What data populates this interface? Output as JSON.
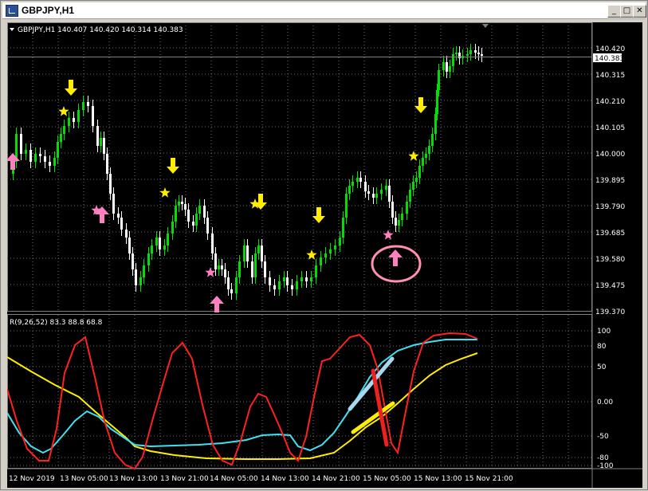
{
  "window": {
    "title": "GBPJPY,H1",
    "buttons": {
      "minimize": "_",
      "maximize": "□",
      "close": "✕"
    }
  },
  "main_chart": {
    "header": "GBPJPY,H1  140.407 140.420 140.314 140.383",
    "price_labels": [
      "140.420",
      "140.315",
      "140.210",
      "140.105",
      "140.000",
      "139.895",
      "139.790",
      "139.685",
      "139.580",
      "139.475",
      "139.370"
    ],
    "current_price": "140.383",
    "colors": {
      "bull": "#00e000",
      "bear": "#ffffff",
      "star": "#ffee00",
      "buy_arrow": "#ff80c0",
      "sell_arrow": "#ffee00"
    }
  },
  "indicator": {
    "header": "R(9,26,52) 83.3 88.8 68.8",
    "levels": [
      "100",
      "80",
      "50",
      "0.00",
      "-50",
      "-80",
      "-100"
    ],
    "series_colors": {
      "fast": "#ff2020",
      "mid": "#40e0f0",
      "slow": "#ffee00"
    }
  },
  "time_axis": {
    "labels": [
      "12 Nov 2019",
      "13 Nov 05:00",
      "13 Nov 13:00",
      "13 Nov 21:00",
      "14 Nov 05:00",
      "14 Nov 13:00",
      "14 Nov 21:00",
      "15 Nov 05:00",
      "15 Nov 13:00",
      "15 Nov 21:00"
    ]
  }
}
